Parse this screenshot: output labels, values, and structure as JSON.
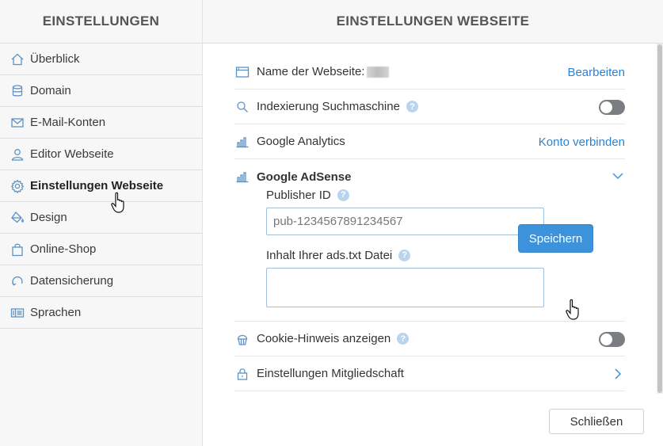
{
  "sidebar": {
    "title": "EINSTELLUNGEN",
    "items": [
      {
        "label": "Überblick",
        "icon": "home-icon"
      },
      {
        "label": "Domain",
        "icon": "database-icon"
      },
      {
        "label": "E-Mail-Konten",
        "icon": "mail-icon"
      },
      {
        "label": "Editor Webseite",
        "icon": "user-icon"
      },
      {
        "label": "Einstellungen Webseite",
        "icon": "gear-icon",
        "active": true
      },
      {
        "label": "Design",
        "icon": "paint-bucket-icon"
      },
      {
        "label": "Online-Shop",
        "icon": "shopping-bag-icon"
      },
      {
        "label": "Datensicherung",
        "icon": "backup-icon"
      },
      {
        "label": "Sprachen",
        "icon": "language-icon"
      }
    ]
  },
  "main": {
    "title": "EINSTELLUNGEN WEBSEITE",
    "site_name": {
      "label": "Name der Webseite:",
      "action": "Bearbeiten"
    },
    "indexing": {
      "label": "Indexierung Suchmaschine",
      "help": "?",
      "enabled": false
    },
    "analytics": {
      "label": "Google Analytics",
      "action": "Konto verbinden"
    },
    "adsense": {
      "label": "Google AdSense",
      "publisher_label": "Publisher ID",
      "publisher_value": "pub-1234567891234567",
      "adstxt_label": "Inhalt Ihrer ads.txt Datei",
      "adstxt_value": "",
      "save_label": "Speichern"
    },
    "cookie": {
      "label": "Cookie-Hinweis anzeigen",
      "help": "?",
      "enabled": false
    },
    "membership": {
      "label": "Einstellungen Mitgliedschaft"
    },
    "close_label": "Schließen"
  },
  "colors": {
    "accent": "#3d93db",
    "link": "#2a84d2",
    "toggle_off": "#7a7e82",
    "help": "#b8d4ee"
  }
}
